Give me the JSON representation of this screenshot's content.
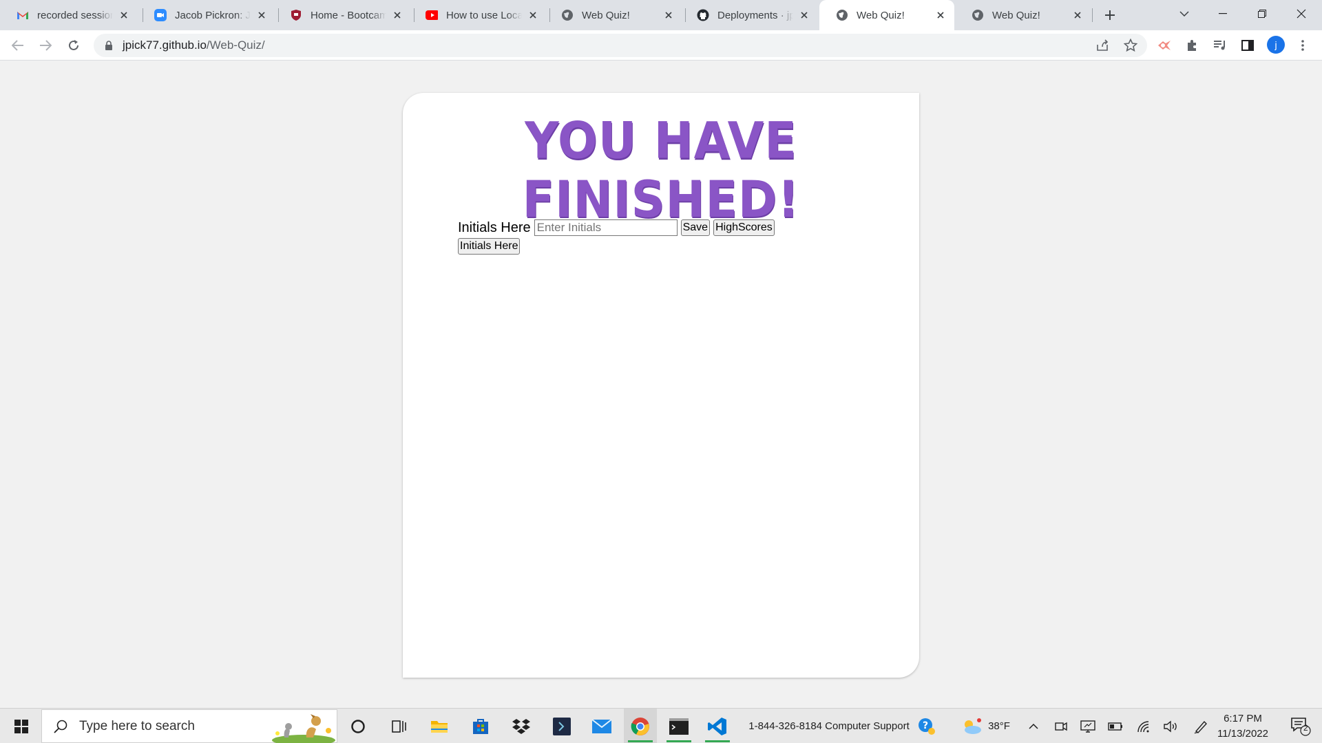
{
  "browser": {
    "tabs": [
      {
        "title": "recorded session",
        "icon": "gmail-icon"
      },
      {
        "title": "Jacob Pickron: Jun",
        "icon": "zoom-icon"
      },
      {
        "title": "Home - Bootcamp",
        "icon": "shield-icon"
      },
      {
        "title": "How to use Local",
        "icon": "youtube-icon"
      },
      {
        "title": "Web Quiz!",
        "icon": "globe-icon"
      },
      {
        "title": "Deployments · jpi",
        "icon": "github-icon"
      },
      {
        "title": "Web Quiz!",
        "icon": "globe-icon",
        "active": true
      },
      {
        "title": "Web Quiz!",
        "icon": "globe-icon"
      }
    ],
    "url_host": "jpick77.github.io",
    "url_path": "/Web-Quiz/",
    "profile_initial": "j"
  },
  "page": {
    "headline": "YOU HAVE FINISHED!",
    "initials_label": "Initials Here",
    "initials_placeholder": "Enter Initials",
    "save_label": "Save",
    "highscores_label": "HighScores",
    "score_entry": "Initials Here"
  },
  "taskbar": {
    "search_placeholder": "Type here to search",
    "support_text": "1-844-326-8184 Computer Support",
    "weather": "38°F",
    "time": "6:17 PM",
    "date": "11/13/2022",
    "notification_count": "2"
  },
  "colors": {
    "headline": "#8a55c6",
    "accent": "#1a73e8"
  }
}
